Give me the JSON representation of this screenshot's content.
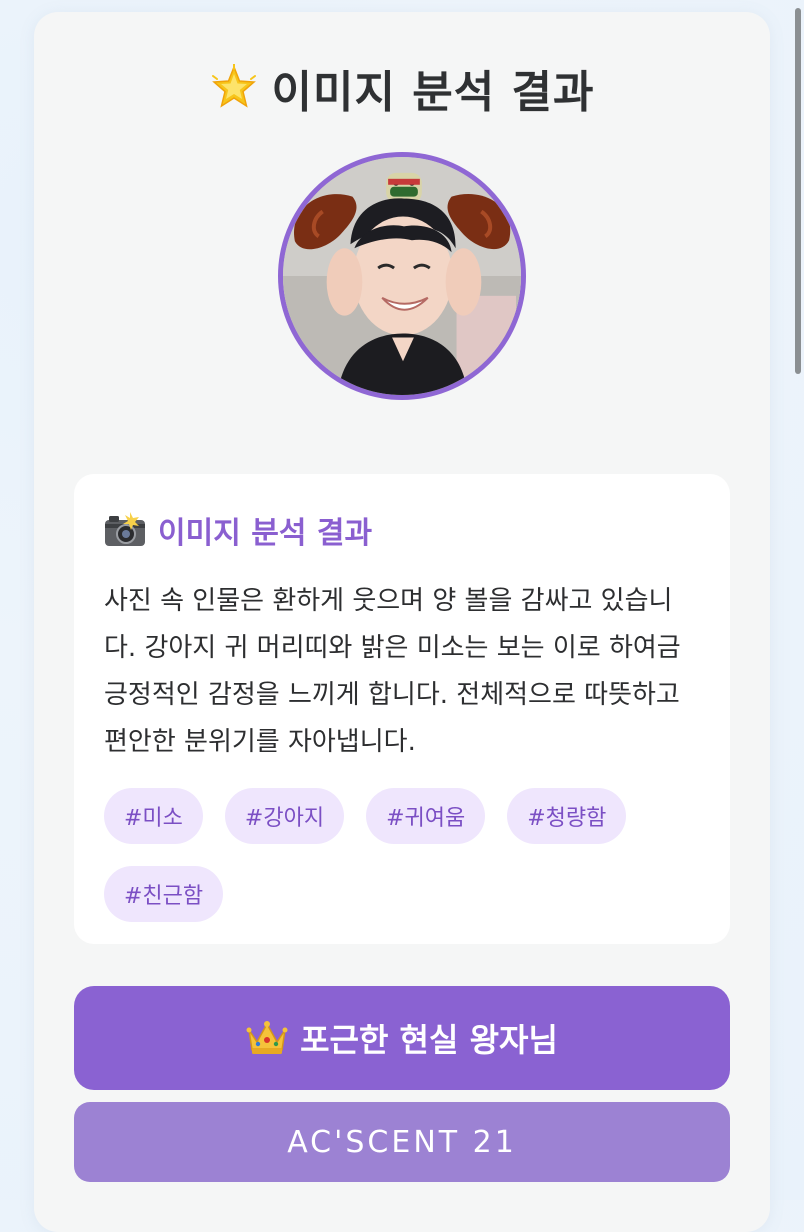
{
  "header": {
    "icon": "glowing-star-icon",
    "title": "이미지 분석 결과"
  },
  "avatar": {
    "description_icon": "profile-photo"
  },
  "analysis": {
    "icon": "camera-flash-icon",
    "title": "이미지 분석 결과",
    "body": "사진 속 인물은 환하게 웃으며 양 볼을 감싸고 있습니다. 강아지 귀 머리띠와 밝은 미소는 보는 이로 하여금 긍정적인 감정을 느끼게 합니다. 전체적으로 따뜻하고 편안한 분위기를 자아냅니다.",
    "tags": [
      "#미소",
      "#강아지",
      "#귀여움",
      "#청량함",
      "#친근함"
    ]
  },
  "result_button": {
    "icon": "crown-icon",
    "label": "포근한 현실 왕자님"
  },
  "brand_button": {
    "label": "AC'SCENT 21"
  },
  "colors": {
    "accent": "#8a62d2",
    "accent_light": "#9c82d3",
    "tag_background": "#efe6fd",
    "tag_text": "#7b4fc4",
    "card_background": "#f5f6f6"
  }
}
